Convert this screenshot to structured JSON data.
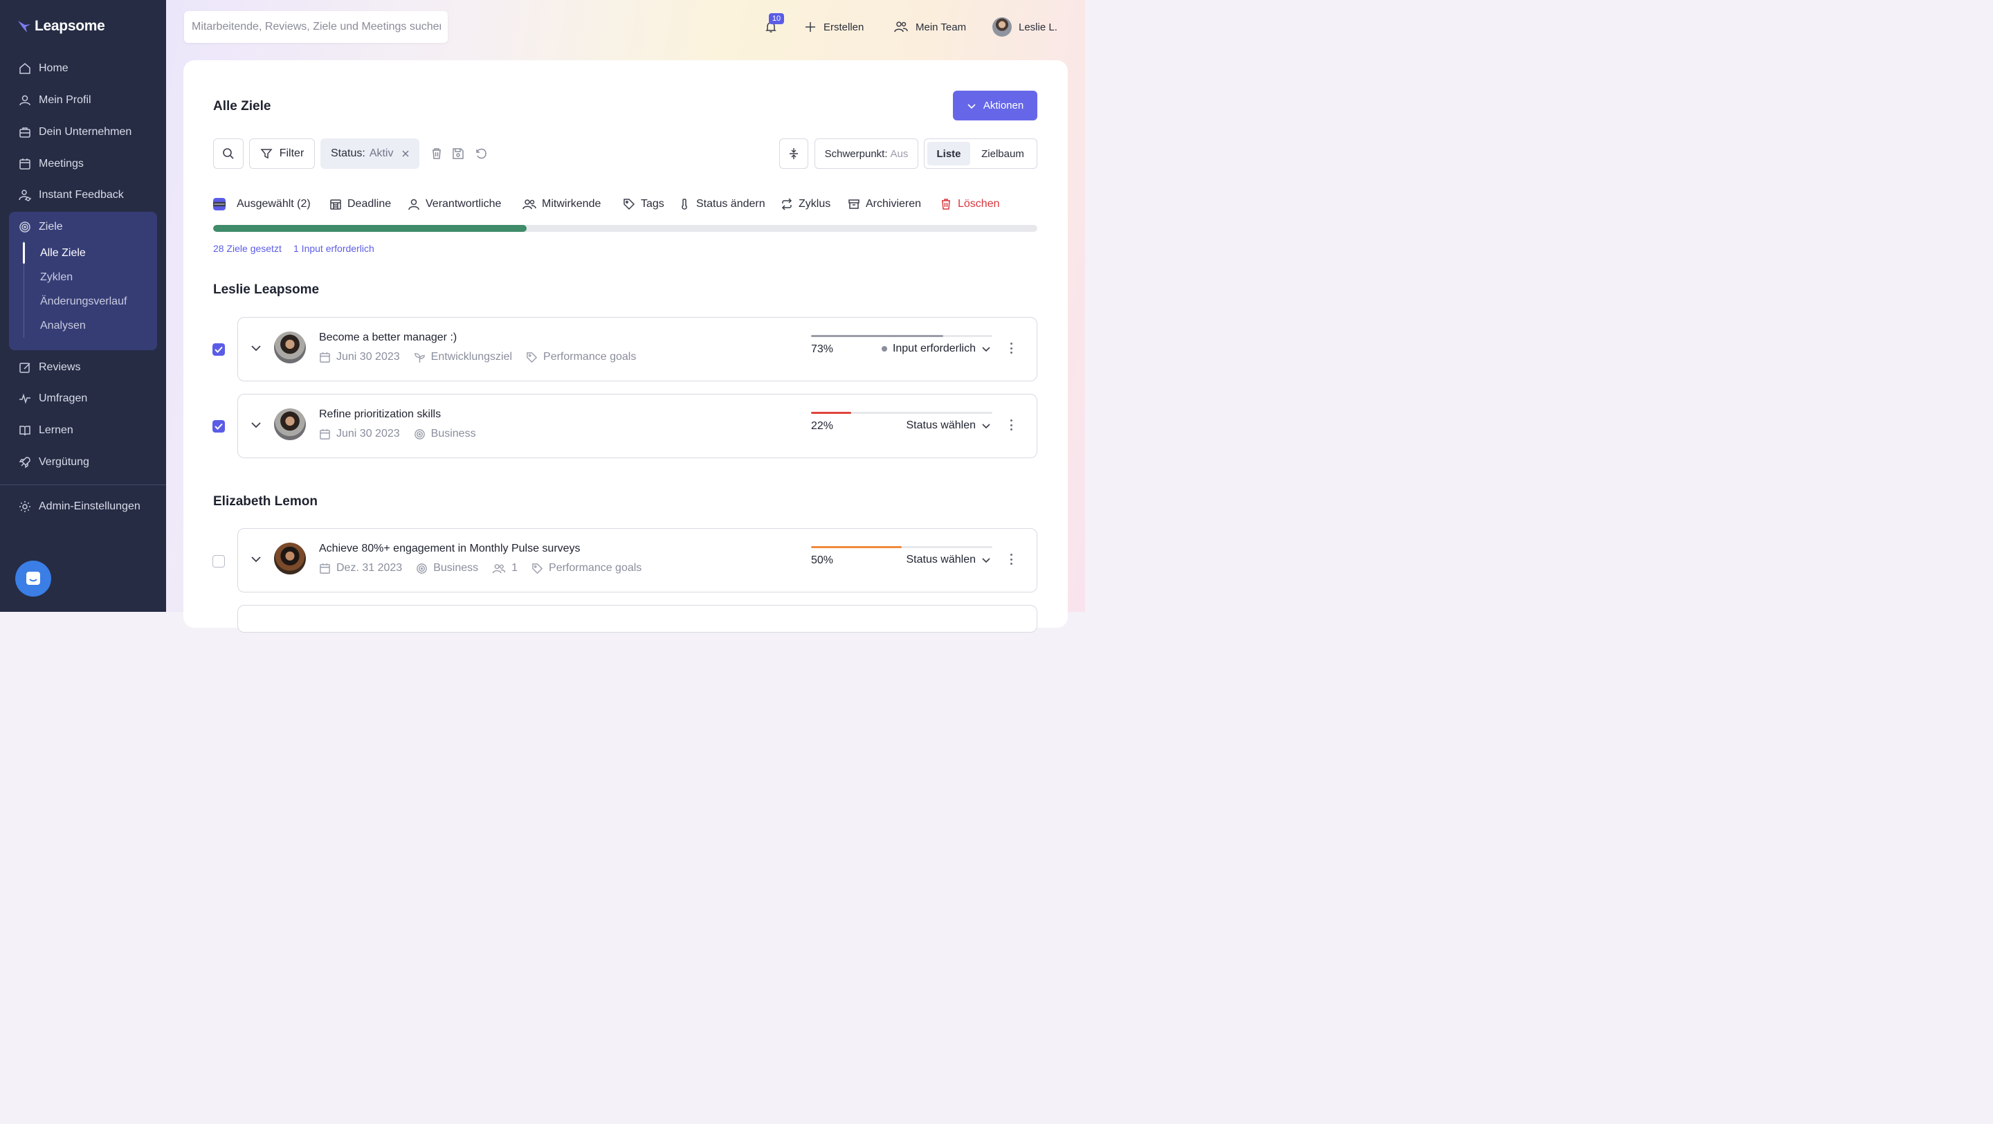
{
  "app": {
    "brand": "Leapsome"
  },
  "sidebar": {
    "items": [
      {
        "label": "Home",
        "icon": "home-icon"
      },
      {
        "label": "Mein Profil",
        "icon": "user-icon"
      },
      {
        "label": "Dein Unternehmen",
        "icon": "briefcase-icon"
      },
      {
        "label": "Meetings",
        "icon": "calendar-icon"
      },
      {
        "label": "Instant Feedback",
        "icon": "feedback-icon"
      },
      {
        "label": "Ziele",
        "icon": "target-icon"
      },
      {
        "label": "Reviews",
        "icon": "edit-icon"
      },
      {
        "label": "Umfragen",
        "icon": "pulse-icon"
      },
      {
        "label": "Lernen",
        "icon": "book-icon"
      },
      {
        "label": "Vergütung",
        "icon": "rocket-icon"
      },
      {
        "label": "Admin-Einstellungen",
        "icon": "gear-icon"
      }
    ],
    "ziele_sub": [
      "Alle Ziele",
      "Zyklen",
      "Änderungsverlauf",
      "Analysen"
    ]
  },
  "topbar": {
    "search_placeholder": "Mitarbeitende, Reviews, Ziele und Meetings suchen",
    "notifications": "10",
    "create": "Erstellen",
    "team": "Mein Team",
    "user": "Leslie L."
  },
  "page": {
    "title": "Alle Ziele",
    "actions": "Aktionen",
    "filter": "Filter",
    "status_chip_label": "Status:",
    "status_chip_value": "Aktiv",
    "focus_label": "Schwerpunkt:",
    "focus_value": "Aus",
    "view_list": "Liste",
    "view_tree": "Zielbaum"
  },
  "bulk": {
    "selected": "Ausgewählt (2)",
    "deadline": "Deadline",
    "owners": "Verantwortliche",
    "contributors": "Mitwirkende",
    "tags": "Tags",
    "change_status": "Status ändern",
    "cycle": "Zyklus",
    "archive": "Archivieren",
    "delete": "Löschen"
  },
  "overall_progress": 0.38,
  "summary": {
    "set": "28 Ziele gesetzt",
    "input": "1 Input erforderlich"
  },
  "groups": [
    {
      "owner": "Leslie Leapsome",
      "goals": [
        {
          "title": "Become a better manager :)",
          "date": "Juni 30 2023",
          "type": "Entwicklungsziel",
          "tag": "Performance goals",
          "pct_label": "73%",
          "progress": 0.73,
          "progress_color": "#9a9da8",
          "status": "Input erforderlich",
          "checked": true
        },
        {
          "title": "Refine prioritization skills",
          "date": "Juni 30 2023",
          "type": "Business",
          "pct_label": "22%",
          "progress": 0.22,
          "progress_color": "#e0443e",
          "status": "Status wählen",
          "checked": true
        }
      ]
    },
    {
      "owner": "Elizabeth Lemon",
      "goals": [
        {
          "title": "Achieve 80%+ engagement in Monthly Pulse surveys",
          "date": "Dez. 31 2023",
          "type": "Business",
          "contributors": "1",
          "tag": "Performance goals",
          "pct_label": "50%",
          "progress": 0.5,
          "progress_color": "#f08a3c",
          "status": "Status wählen",
          "checked": false
        }
      ]
    }
  ],
  "colors": {
    "sidebar": "#262c44",
    "accent": "#6667e8",
    "progress_main": "#3f8b6a",
    "danger": "#d9363e"
  }
}
